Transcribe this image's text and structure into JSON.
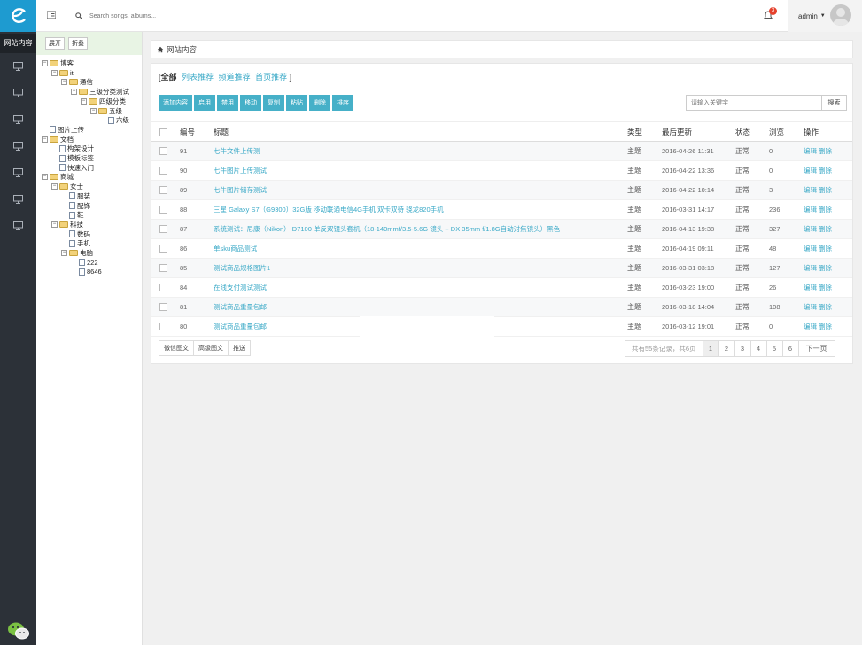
{
  "sidebar": {
    "active_label": "网站内容",
    "items": [
      "monitor-icon",
      "monitor-icon",
      "monitor-icon",
      "monitor-icon",
      "monitor-icon",
      "monitor-icon",
      "monitor-icon"
    ]
  },
  "header": {
    "search_placeholder": "Search songs, albums...",
    "notification_count": "3",
    "user_name": "admin"
  },
  "tree": {
    "expand_label": "展开",
    "collapse_label": "折叠",
    "nodes": [
      {
        "label": "博客",
        "depth": 0,
        "kind": "folder",
        "toggle": "−"
      },
      {
        "label": "it",
        "depth": 1,
        "kind": "folder",
        "toggle": "−"
      },
      {
        "label": "通信",
        "depth": 2,
        "kind": "folder",
        "toggle": "−"
      },
      {
        "label": "三级分类测试",
        "depth": 3,
        "kind": "folder",
        "toggle": "−"
      },
      {
        "label": "四级分类",
        "depth": 4,
        "kind": "folder",
        "toggle": "−"
      },
      {
        "label": "五级",
        "depth": 5,
        "kind": "folder",
        "toggle": "−"
      },
      {
        "label": "六级",
        "depth": 6,
        "kind": "file",
        "toggle": ""
      },
      {
        "label": "图片上传",
        "depth": 0,
        "kind": "file",
        "toggle": ""
      },
      {
        "label": "文档",
        "depth": 0,
        "kind": "folder",
        "toggle": "−"
      },
      {
        "label": "构架设计",
        "depth": 1,
        "kind": "file",
        "toggle": ""
      },
      {
        "label": "模板标签",
        "depth": 1,
        "kind": "file",
        "toggle": ""
      },
      {
        "label": "快速入门",
        "depth": 1,
        "kind": "file",
        "toggle": ""
      },
      {
        "label": "商城",
        "depth": 0,
        "kind": "folder",
        "toggle": "−"
      },
      {
        "label": "女士",
        "depth": 1,
        "kind": "folder",
        "toggle": "−"
      },
      {
        "label": "服装",
        "depth": 2,
        "kind": "file",
        "toggle": ""
      },
      {
        "label": "配饰",
        "depth": 2,
        "kind": "file",
        "toggle": ""
      },
      {
        "label": "鞋",
        "depth": 2,
        "kind": "file",
        "toggle": ""
      },
      {
        "label": "科技",
        "depth": 1,
        "kind": "folder",
        "toggle": "−"
      },
      {
        "label": "数码",
        "depth": 2,
        "kind": "file",
        "toggle": ""
      },
      {
        "label": "手机",
        "depth": 2,
        "kind": "file",
        "toggle": ""
      },
      {
        "label": "电脑",
        "depth": 2,
        "kind": "folder",
        "toggle": "−"
      },
      {
        "label": "222",
        "depth": 3,
        "kind": "file",
        "toggle": ""
      },
      {
        "label": "8646",
        "depth": 3,
        "kind": "file",
        "toggle": ""
      }
    ]
  },
  "breadcrumb": "网站内容",
  "filters": {
    "open_bracket": "[",
    "all": "全部",
    "links": [
      "列表推荐",
      "频道推荐",
      "首页推荐"
    ],
    "close_bracket": "]"
  },
  "toolbar": [
    "添加内容",
    "启用",
    "禁用",
    "移动",
    "复制",
    "粘贴",
    "删除",
    "排序"
  ],
  "keyword": {
    "placeholder": "请输入关键字",
    "button": "搜索"
  },
  "table": {
    "headers": [
      "编号",
      "标题",
      "类型",
      "最后更新",
      "状态",
      "浏览",
      "操作"
    ],
    "rows": [
      {
        "id": "91",
        "title": "七牛文件上传测",
        "type": "主题",
        "updated": "2016-04-26 11:31",
        "status": "正常",
        "views": "0"
      },
      {
        "id": "90",
        "title": "七牛图片上传测试",
        "type": "主题",
        "updated": "2016-04-22 13:36",
        "status": "正常",
        "views": "0"
      },
      {
        "id": "89",
        "title": "七牛图片储存测试",
        "type": "主题",
        "updated": "2016-04-22 10:14",
        "status": "正常",
        "views": "3"
      },
      {
        "id": "88",
        "title": "三星 Galaxy S7（G9300）32G版 移动联通电信4G手机 双卡双待 骁龙820手机",
        "type": "主题",
        "updated": "2016-03-31 14:17",
        "status": "正常",
        "views": "236"
      },
      {
        "id": "87",
        "title": "系统测试：尼康（Nikon） D7100 单反双镜头套机（18-140mmf/3.5-5.6G 镜头 + DX 35mm f/1.8G自动对焦镜头）黑色",
        "type": "主题",
        "updated": "2016-04-13 19:38",
        "status": "正常",
        "views": "327"
      },
      {
        "id": "86",
        "title": "单sku商品测试",
        "type": "主题",
        "updated": "2016-04-19 09:11",
        "status": "正常",
        "views": "48"
      },
      {
        "id": "85",
        "title": "测试商品规格图片1",
        "type": "主题",
        "updated": "2016-03-31 03:18",
        "status": "正常",
        "views": "127"
      },
      {
        "id": "84",
        "title": "在线支付测试测试",
        "type": "主题",
        "updated": "2016-03-23 19:00",
        "status": "正常",
        "views": "26"
      },
      {
        "id": "81",
        "title": "测试商品重量包邮",
        "type": "主题",
        "updated": "2016-03-18 14:04",
        "status": "正常",
        "views": "108"
      },
      {
        "id": "80",
        "title": "测试商品重量包邮",
        "type": "主题",
        "updated": "2016-03-12 19:01",
        "status": "正常",
        "views": "0"
      }
    ],
    "edit_label": "编辑",
    "delete_label": "删除"
  },
  "bottom_buttons": [
    "微信图文",
    "高级图文",
    "推送"
  ],
  "pagination": {
    "info": "共有55条记录，共6页",
    "pages": [
      "1",
      "2",
      "3",
      "4",
      "5",
      "6"
    ],
    "current": "1",
    "next": "下一页"
  },
  "colors": {
    "accent": "#46b0c8",
    "link": "#3aa9c7",
    "sidebar": "#2c3138",
    "logo_bg": "#1e9bd0",
    "badge": "#e5412d"
  }
}
